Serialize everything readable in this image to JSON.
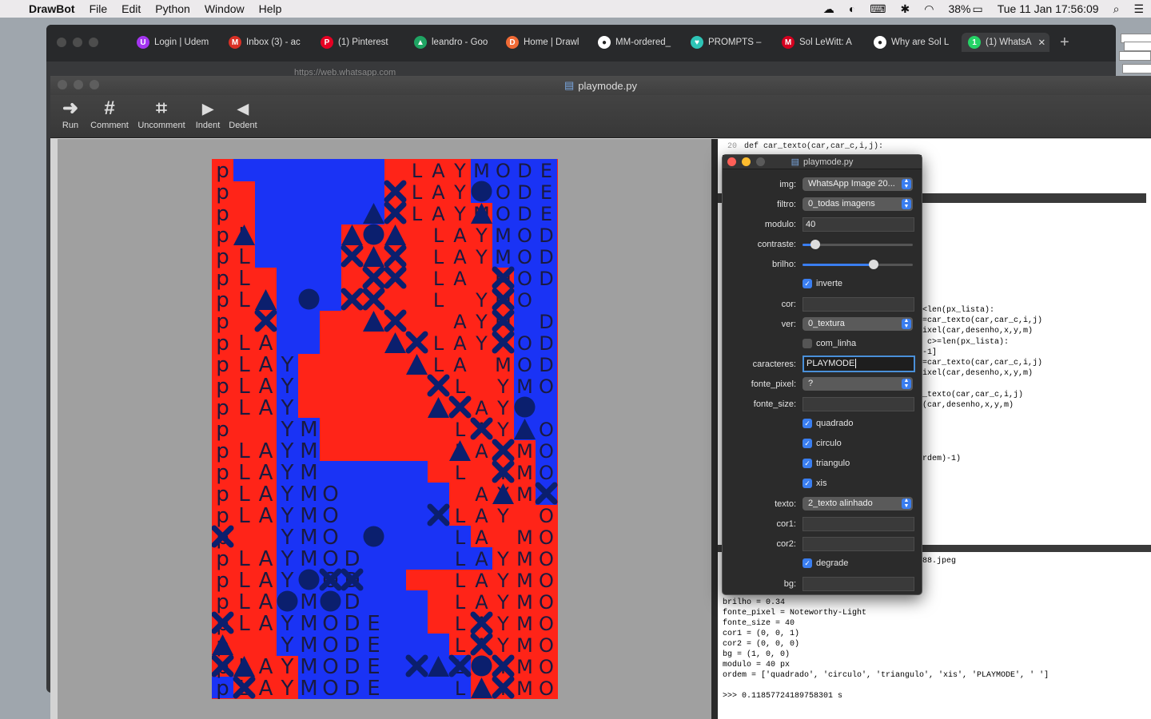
{
  "menubar": {
    "app_name": "DrawBot",
    "items": [
      "File",
      "Edit",
      "Python",
      "Window",
      "Help"
    ],
    "battery": "38%",
    "clock": "Tue 11 Jan  17:56:09"
  },
  "browser": {
    "tabs": [
      {
        "title": "Login | Udem",
        "color": "#a435f0",
        "glyph": "U"
      },
      {
        "title": "Inbox (3) - ac",
        "color": "#d93025",
        "glyph": "M"
      },
      {
        "title": "(1) Pinterest",
        "color": "#e60023",
        "glyph": "P"
      },
      {
        "title": "leandro - Goo",
        "color": "#1fa463",
        "glyph": "▲"
      },
      {
        "title": "Home | Drawl",
        "color": "#f06a35",
        "glyph": "D"
      },
      {
        "title": "MM-ordered_",
        "color": "#ffffff",
        "glyph": "●"
      },
      {
        "title": "PROMPTS –",
        "color": "#2ec4b6",
        "glyph": "♥"
      },
      {
        "title": "Sol LeWitt: A",
        "color": "#d4001f",
        "glyph": "M"
      },
      {
        "title": "Why are Sol L",
        "color": "#ffffff",
        "glyph": "●"
      },
      {
        "title": "(1) WhatsA",
        "color": "#25d366",
        "glyph": "1",
        "active": true
      }
    ],
    "url": "https://web.whatsapp.com"
  },
  "drawbot": {
    "window_title": "playmode.py",
    "toolbar": [
      {
        "label": "Run",
        "icon": "run-arrow-icon",
        "glyph": "➜"
      },
      {
        "label": "Comment",
        "icon": "comment-hash-icon",
        "glyph": "#"
      },
      {
        "label": "Uncomment",
        "icon": "uncomment-hash-icon",
        "glyph": "⌗"
      },
      {
        "label": "Indent",
        "icon": "indent-triangle-icon",
        "glyph": "▶"
      },
      {
        "label": "Dedent",
        "icon": "dedent-triangle-icon",
        "glyph": "◀"
      }
    ],
    "code_lines": [
      {
        "n": "20",
        "text": "def car_texto(car,car_c,i,j):"
      }
    ],
    "code_fragments": [
      "<len(px_lista):",
      "=car_texto(car,car_c,i,j)",
      "ixel(car,desenho,x,y,m)",
      " c>=len(px_lista):",
      "-1]",
      "=car_texto(car,car_c,i,j)",
      "ixel(car,desenho,x,y,m)",
      "_texto(car,car_c,i,j)",
      "(car,desenho,x,y,m)",
      "rdem)-1)"
    ],
    "output_lines": [
      "88.jpeg",
      "brilho = 0.34",
      "fonte_pixel = Noteworthy-Light",
      "fonte_size = 40",
      "cor1 = (0, 0, 1)",
      "cor2 = (0, 0, 0)",
      "bg = (1, 0, 0)",
      "modulo = 40 px",
      "ordem = ['quadrado', 'circulo', 'triangulo', 'xis', 'PLAYMODE', ' ']",
      "",
      ">>> 0.11857724189758301 s"
    ]
  },
  "variables": {
    "title": "playmode.py",
    "img_label": "img:",
    "img_value": "WhatsApp Image 20...",
    "filtro_label": "filtro:",
    "filtro_value": "0_todas imagens",
    "modulo_label": "modulo:",
    "modulo_value": "40",
    "contraste_label": "contraste:",
    "contraste_level": 0.08,
    "brilho_label": "brilho:",
    "brilho_level": 0.66,
    "inverte_label": "inverte",
    "inverte_checked": true,
    "cor_label": "cor:",
    "ver_label": "ver:",
    "ver_value": "0_textura",
    "com_linha_label": "com_linha",
    "com_linha_checked": false,
    "caracteres_label": "caracteres:",
    "caracteres_value": "PLAYMODE",
    "fonte_pixel_label": "fonte_pixel:",
    "fonte_pixel_value": "?",
    "fonte_size_label": "fonte_size:",
    "quadrado_label": "quadrado",
    "circulo_label": "circulo",
    "triangulo_label": "triangulo",
    "xis_label": "xis",
    "texto_label": "texto:",
    "texto_value": "2_texto alinhado",
    "cor1_label": "cor1:",
    "cor2_label": "cor2:",
    "degrade_label": "degrade",
    "degrade_checked": true,
    "bg_label": "bg:"
  },
  "artwork": {
    "text": "PLAYMODE",
    "colors": {
      "background": "#ff2418",
      "blue": "#1a33f5",
      "shape": "#0b1f6e",
      "text": "#1a1a40"
    }
  }
}
